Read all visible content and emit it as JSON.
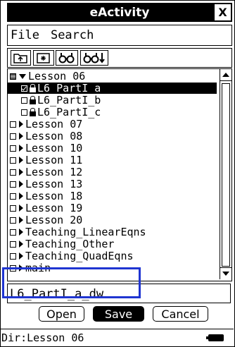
{
  "window": {
    "title": "eActivity",
    "close_label": "X"
  },
  "menu": {
    "items": [
      "File",
      "Search"
    ]
  },
  "toolbar": {
    "buttons": [
      {
        "name": "up-folder-icon"
      },
      {
        "name": "new-folder-icon"
      },
      {
        "name": "search-icon"
      },
      {
        "name": "search-next-icon"
      }
    ]
  },
  "list": {
    "items": [
      {
        "label": "Lesson 06",
        "kind": "folder-open",
        "checkbox": "grid",
        "indent": 0
      },
      {
        "label": "L6_PartI_a",
        "kind": "file-locked",
        "checkbox": "checked",
        "indent": 1,
        "selected": true
      },
      {
        "label": "L6_PartI_b",
        "kind": "file-locked",
        "checkbox": "empty",
        "indent": 1
      },
      {
        "label": "L6_PartI_c",
        "kind": "file-locked",
        "checkbox": "empty",
        "indent": 1
      },
      {
        "label": "Lesson 07",
        "kind": "folder",
        "checkbox": "empty",
        "indent": 0
      },
      {
        "label": "Lesson 08",
        "kind": "folder",
        "checkbox": "empty",
        "indent": 0
      },
      {
        "label": "Lesson 10",
        "kind": "folder",
        "checkbox": "empty",
        "indent": 0
      },
      {
        "label": "Lesson 11",
        "kind": "folder",
        "checkbox": "empty",
        "indent": 0
      },
      {
        "label": "Lesson 12",
        "kind": "folder",
        "checkbox": "empty",
        "indent": 0
      },
      {
        "label": "Lesson 13",
        "kind": "folder",
        "checkbox": "empty",
        "indent": 0
      },
      {
        "label": "Lesson 18",
        "kind": "folder",
        "checkbox": "empty",
        "indent": 0
      },
      {
        "label": "Lesson 19",
        "kind": "folder",
        "checkbox": "empty",
        "indent": 0
      },
      {
        "label": "Lesson 20",
        "kind": "folder",
        "checkbox": "empty",
        "indent": 0
      },
      {
        "label": "Teaching_LinearEqns",
        "kind": "folder",
        "checkbox": "empty",
        "indent": 0
      },
      {
        "label": "Teaching_Other",
        "kind": "folder",
        "checkbox": "empty",
        "indent": 0
      },
      {
        "label": "Teaching_QuadEqns",
        "kind": "folder",
        "checkbox": "empty",
        "indent": 0
      },
      {
        "label": "main",
        "kind": "folder",
        "checkbox": "empty",
        "indent": 0
      }
    ]
  },
  "filename": {
    "value": "L6_PartI_a_dw"
  },
  "buttons": {
    "open": "Open",
    "save": "Save",
    "cancel": "Cancel"
  },
  "status": {
    "dir": "Dir:Lesson 06"
  },
  "colors": {
    "highlight": "#1f35d1"
  }
}
